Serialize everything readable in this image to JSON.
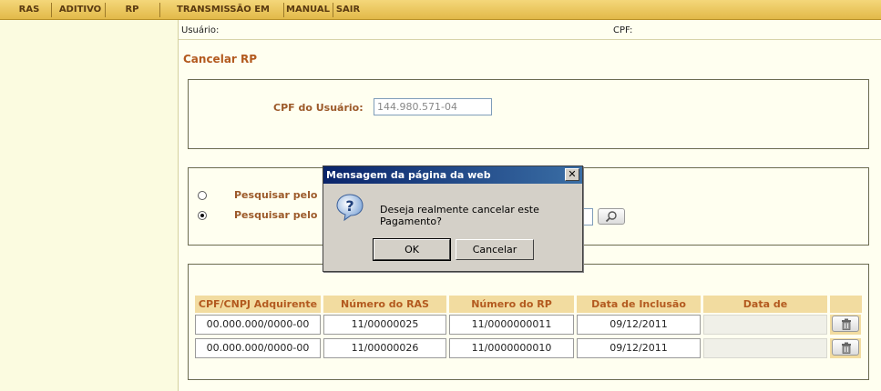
{
  "menu": {
    "items": [
      "RAS",
      "ADITIVO",
      "RP",
      "TRANSMISSÃO EM LOTE",
      "MANUAL",
      "SAIR"
    ]
  },
  "userbar": {
    "user_label": "Usuário:",
    "cpf_label": "CPF:"
  },
  "page_title": "Cancelar RP",
  "cpf_form": {
    "label": "CPF do Usuário:",
    "value": "144.980.571-04"
  },
  "search": {
    "option1_label": "Pesquisar pelo",
    "option2_label": "Pesquisar pelo",
    "selected": 2,
    "button_icon": "magnifier-icon"
  },
  "table": {
    "headers": [
      "CPF/CNPJ Adquirente",
      "Número do RAS",
      "Número do RP",
      "Data de Inclusão",
      "Data de Cancelamento"
    ],
    "rows": [
      {
        "cpf_cnpj": "00.000.000/0000-00",
        "ras": "11/00000025",
        "rp": "11/0000000011",
        "inclusao": "09/12/2011",
        "cancelamento": ""
      },
      {
        "cpf_cnpj": "00.000.000/0000-00",
        "ras": "11/00000026",
        "rp": "11/0000000010",
        "inclusao": "09/12/2011",
        "cancelamento": ""
      }
    ],
    "action_icon": "trash-icon"
  },
  "dialog": {
    "title": "Mensagem da página da web",
    "close": "✕",
    "message": "Deseja realmente cancelar este Pagamento?",
    "icon": "question-icon",
    "ok_label": "OK",
    "cancel_label": "Cancelar"
  },
  "colors": {
    "menu_bg": "#e2b949",
    "accent_text": "#b35a1f",
    "table_header_bg": "#f2dca0",
    "dialog_title_bg": "#0a246a"
  }
}
